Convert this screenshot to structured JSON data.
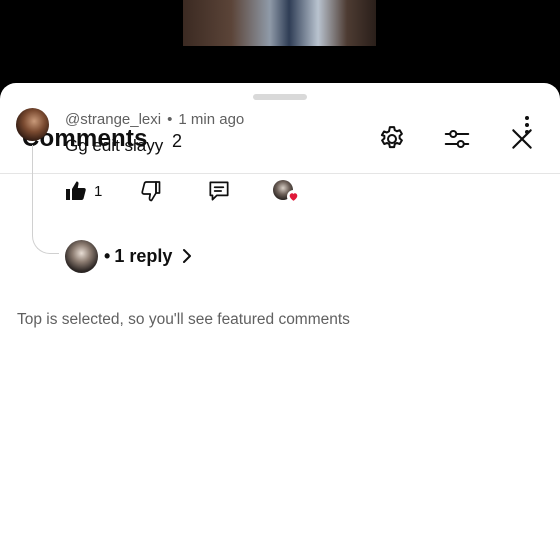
{
  "panel": {
    "title": "Comments",
    "count": "2"
  },
  "comment": {
    "username": "@strange_lexi",
    "separator": "•",
    "time": "1 min ago",
    "text": "Gg edit slayy",
    "like_count": "1"
  },
  "replies": {
    "bullet": "•",
    "label": "1 reply"
  },
  "footer": {
    "note": "Top is selected, so you'll see featured comments"
  },
  "colors": {
    "heart": "#e0193a",
    "secondary_text": "#606060"
  },
  "icons": [
    "gear-icon",
    "sliders-icon",
    "close-icon",
    "more-vert-icon",
    "thumbs-up-icon",
    "thumbs-down-icon",
    "comment-icon",
    "heart-icon",
    "chevron-right-icon"
  ]
}
